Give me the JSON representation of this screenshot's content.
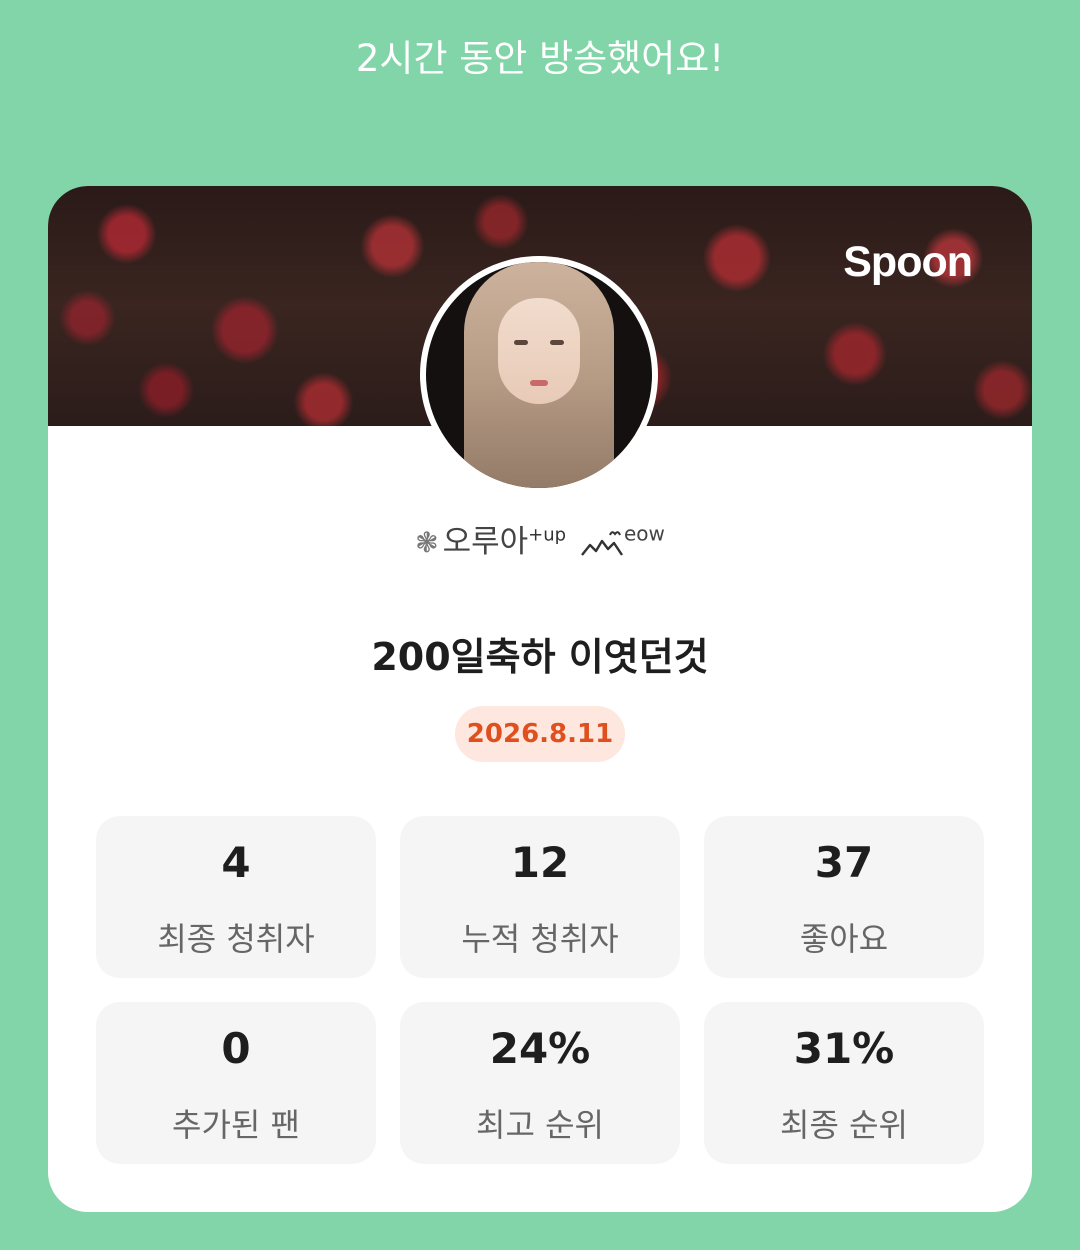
{
  "header": {
    "message": "2시간 동안 방송했어요!"
  },
  "card": {
    "brand": "Spoon",
    "nickname": {
      "flower": "❃",
      "name": "오루아",
      "sup": "+up",
      "tail": "eow"
    },
    "title": "200일축하 이엿던것",
    "date": "2026.8.11"
  },
  "stats": [
    {
      "value": "4",
      "label": "최종 청취자"
    },
    {
      "value": "12",
      "label": "누적 청취자"
    },
    {
      "value": "37",
      "label": "좋아요"
    },
    {
      "value": "0",
      "label": "추가된 팬"
    },
    {
      "value": "24%",
      "label": "최고 순위"
    },
    {
      "value": "31%",
      "label": "최종 순위"
    }
  ],
  "colors": {
    "background": "#82d5a8",
    "card": "#ffffff",
    "date_badge_bg": "#fde7df",
    "date_text": "#e0501f",
    "stat_tile": "#f5f5f5"
  }
}
